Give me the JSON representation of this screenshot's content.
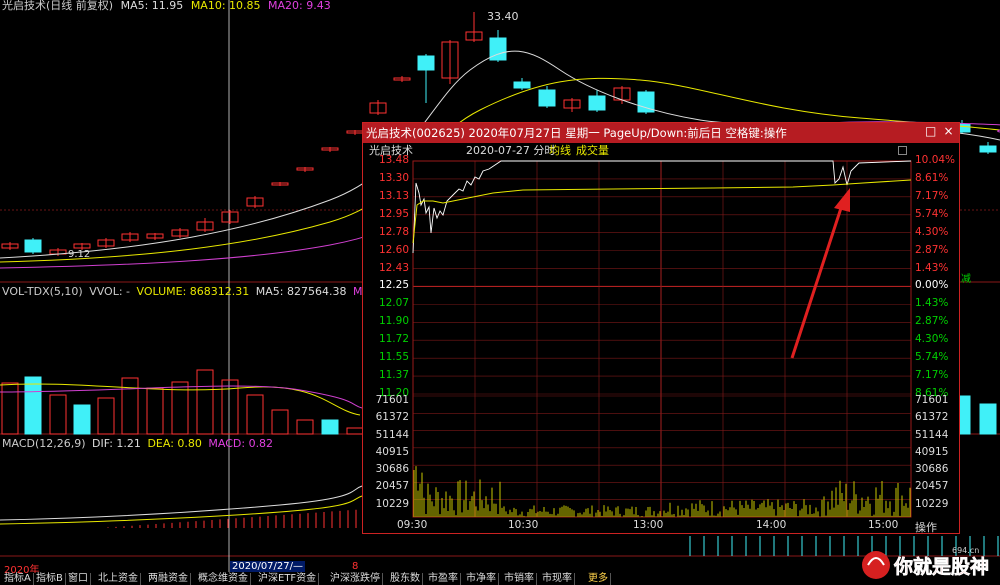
{
  "main_chart": {
    "title": "光启技术(日线 前复权)",
    "ma5": "MA5: 11.95",
    "ma10": "MA10: 10.85",
    "ma20": "MA20: 9.43",
    "high_price": "33.40",
    "low_price": "9.12"
  },
  "volume_panel": {
    "name": "VOL-TDX(5,10)",
    "vvol": "VVOL: -",
    "volume": "VOLUME: 868312.31",
    "ma5": "MA5: 827564.38",
    "ma10": "MA10"
  },
  "macd_panel": {
    "name": "MACD(12,26,9)",
    "dif": "DIF: 1.21",
    "dea": "DEA: 0.80",
    "macd": "MACD: 0.82"
  },
  "side_label": "减",
  "date_axis": {
    "year": "2020年",
    "cursor_date": "2020/07/27/—",
    "month": "8"
  },
  "popup": {
    "title": "光启技术(002625)  2020年07月27日  星期一  PageUp/Down:前后日  空格键:操作",
    "stock_name": "光启技术",
    "date_label": "2020-07-27 分时",
    "avg_line_label": "均线",
    "volume_label": "成交量",
    "price_labels": [
      "13.48",
      "13.30",
      "13.13",
      "12.95",
      "12.78",
      "12.60",
      "12.43",
      "12.25",
      "12.07",
      "11.90",
      "11.72",
      "11.55",
      "11.37",
      "11.20"
    ],
    "pct_labels": [
      "10.04%",
      "8.61%",
      "7.17%",
      "5.74%",
      "4.30%",
      "2.87%",
      "1.43%",
      "0.00%",
      "1.43%",
      "2.87%",
      "4.30%",
      "5.74%",
      "7.17%",
      "8.61%"
    ],
    "vol_labels": [
      "71601",
      "61372",
      "51144",
      "40915",
      "30686",
      "20457",
      "10229"
    ],
    "time_labels": [
      "09:30",
      "10:30",
      "13:00",
      "14:00",
      "15:00"
    ],
    "op_button": "操作",
    "colors": {
      "up": "#ff3232",
      "down": "#00d000",
      "neutral": "#ffffff",
      "price_line": "#ffffff",
      "avg_line": "#e8e800",
      "volume": "#c8c800"
    }
  },
  "bottom_tabs": [
    "指标A",
    "指标B",
    "窗口",
    "北上资金",
    "两融资金",
    "概念维资金",
    "沪深ETF资金",
    "沪深涨跌停",
    "股东数",
    "市盈率",
    "市净率",
    "市销率",
    "市现率",
    "更多"
  ],
  "watermark": {
    "text": "你就是股神",
    "site": "694.cn"
  },
  "chart_data": {
    "type": "line",
    "title": "",
    "x": [
      "09:30",
      "10:30",
      "13:00",
      "14:00",
      "15:00"
    ],
    "series": [
      {
        "name": "price",
        "values": [
          12.95,
          13.48,
          13.48,
          13.48,
          13.48
        ]
      }
    ],
    "ylim": [
      11.2,
      13.48
    ]
  }
}
